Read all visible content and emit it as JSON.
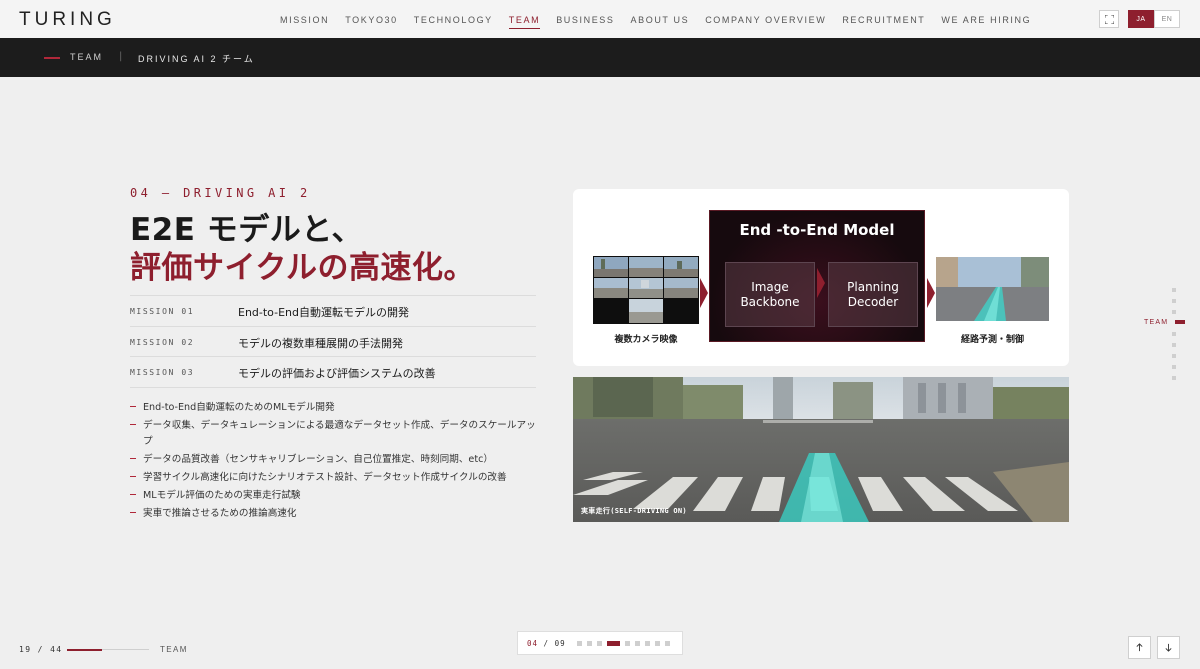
{
  "header": {
    "logo": "TURING",
    "nav": [
      {
        "label": "MISSION",
        "active": false
      },
      {
        "label": "TOKYO30",
        "active": false
      },
      {
        "label": "TECHNOLOGY",
        "active": false
      },
      {
        "label": "TEAM",
        "active": true
      },
      {
        "label": "BUSINESS",
        "active": false
      },
      {
        "label": "ABOUT US",
        "active": false
      },
      {
        "label": "COMPANY OVERVIEW",
        "active": false
      },
      {
        "label": "RECRUITMENT",
        "active": false
      },
      {
        "label": "WE ARE HIRING",
        "active": false
      }
    ],
    "lang": {
      "ja": "JA",
      "en": "EN",
      "selected": "JA"
    }
  },
  "breadcrumb": {
    "section": "TEAM",
    "separator": "|",
    "title": "DRIVING AI 2 チーム"
  },
  "content": {
    "eyebrow": "04 — DRIVING AI 2",
    "headline_line1": "E2E モデルと、",
    "headline_line2": "評価サイクルの高速化。",
    "missions": [
      {
        "code": "MISSION 01",
        "text": "End-to-End自動運転モデルの開発"
      },
      {
        "code": "MISSION 02",
        "text": "モデルの複数車種展開の手法開発"
      },
      {
        "code": "MISSION 03",
        "text": "モデルの評価および評価システムの改善"
      }
    ],
    "bullets": [
      "End-to-End自動運転のためのMLモデル開発",
      "データ収集、データキュレーションによる最適なデータセット作成、データのスケールアップ",
      "データの品質改善（センサキャリブレーション、自己位置推定、時刻同期、etc）",
      "学習サイクル高速化に向けたシナリオテスト設計、データセット作成サイクルの改善",
      "MLモデル評価のための実車走行試験",
      "実車で推論させるための推論高速化"
    ]
  },
  "diagram": {
    "model_title": "End -to-End Model",
    "module1_line1": "Image",
    "module1_line2": "Backbone",
    "module2_line1": "Planning",
    "module2_line2": "Decoder",
    "input_label": "複数カメラ映像",
    "output_label": "経路予測・制御"
  },
  "video": {
    "caption": "実車走行(SELF-DRIVING ON)"
  },
  "side_nav": {
    "label": "TEAM"
  },
  "pager": {
    "current": "19",
    "sep": "/",
    "total": "44",
    "progress": 0.43,
    "section": "TEAM"
  },
  "sub_pager": {
    "current": "04",
    "sep": "/",
    "total": "09",
    "count": 9,
    "active_index": 3
  },
  "colors": {
    "accent": "#8e1f2e",
    "dark_bar": "#1c1c1c",
    "background": "#efefef"
  },
  "icons": {
    "fullscreen": "fullscreen-icon",
    "up": "arrow-up-icon",
    "down": "arrow-down-icon"
  }
}
